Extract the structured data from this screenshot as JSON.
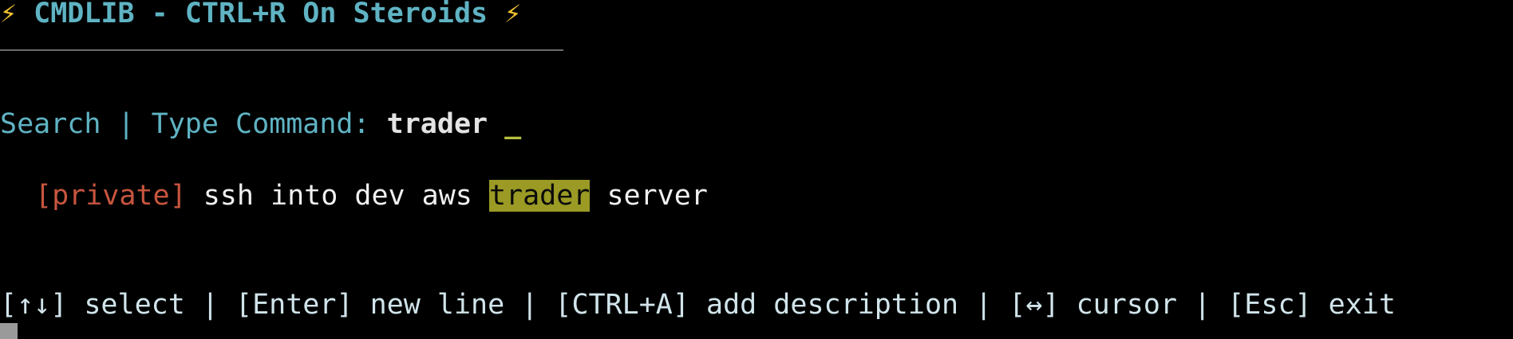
{
  "header": {
    "bolt": "⚡",
    "title": " CMDLIB - CTRL+R On Steroids "
  },
  "search": {
    "label": "Search | Type Command: ",
    "query": "trader",
    "cursor": " _"
  },
  "results": [
    {
      "tag": "[private]",
      "before": " ssh into dev aws ",
      "match": "trader",
      "after": " server"
    }
  ],
  "help": {
    "text": "[↑↓] select | [Enter] new line | [CTRL+A] add description | [↔] cursor | [Esc] exit"
  },
  "colors": {
    "background": "#000000",
    "title": "#5fb3c3",
    "tag": "#c8553f",
    "highlight": "#9a9a25",
    "help": "#d0e4ea"
  }
}
